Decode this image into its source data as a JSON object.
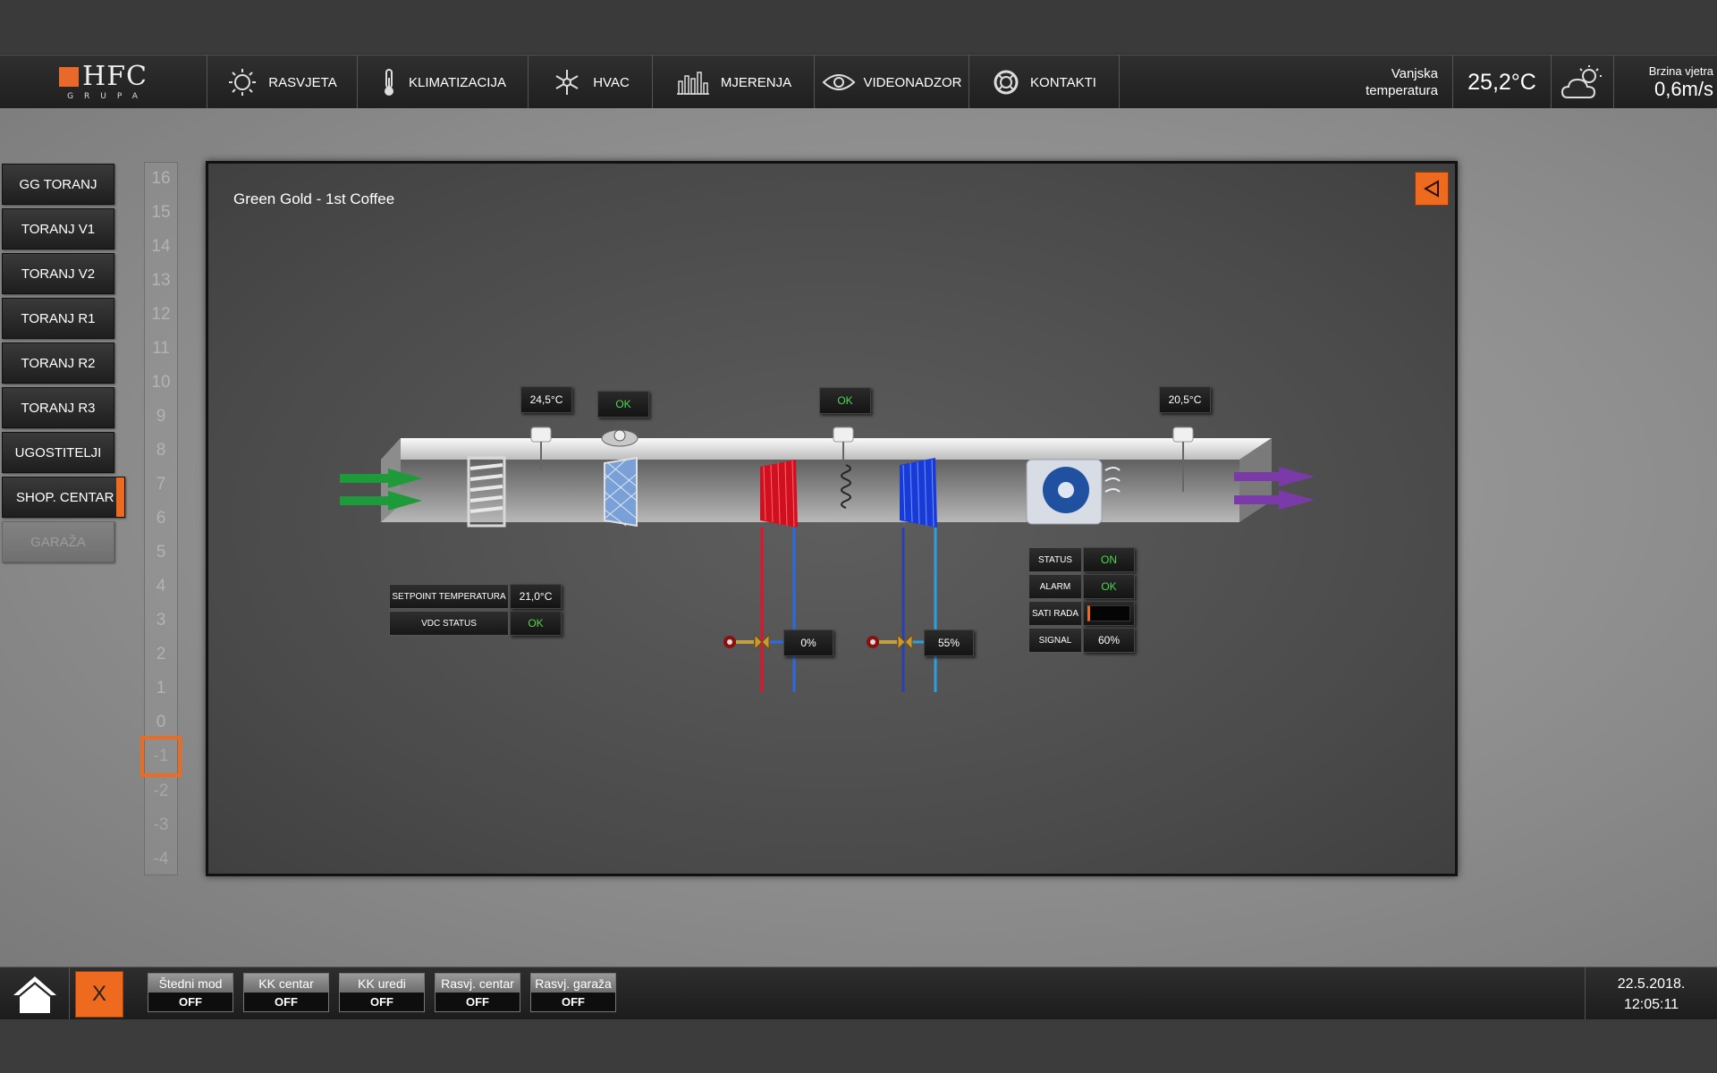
{
  "header": {
    "logo": {
      "text": "HFC",
      "sub": "GRUPA"
    },
    "tabs": [
      {
        "label": "RASVJETA",
        "icon": "lightbulb-icon"
      },
      {
        "label": "KLIMATIZACIJA",
        "icon": "thermometer-icon"
      },
      {
        "label": "HVAC",
        "icon": "snowflake-sun-icon"
      },
      {
        "label": "MJERENJA",
        "icon": "bar-chart-icon"
      },
      {
        "label": "VIDEONADZOR",
        "icon": "eye-icon"
      },
      {
        "label": "KONTAKTI",
        "icon": "lifebuoy-icon"
      }
    ],
    "active_tab": "KLIMATIZACIJA",
    "outdoor_temp_label_1": "Vanjska",
    "outdoor_temp_label_2": "temperatura",
    "outdoor_temp": "25,2°C",
    "weather_icon": "cloud-sun-icon",
    "wind_label": "Brzina vjetra",
    "wind_speed": "0,6m/s"
  },
  "sidebar": {
    "buildings": [
      "GG TORANJ",
      "TORANJ V1",
      "TORANJ V2",
      "TORANJ R1",
      "TORANJ R2",
      "TORANJ R3",
      "UGOSTITELJI",
      "SHOP. CENTAR",
      "GARAŽA"
    ],
    "active": "SHOP. CENTAR",
    "disabled": "GARAŽA",
    "floors": [
      "16",
      "15",
      "14",
      "13",
      "12",
      "11",
      "10",
      "9",
      "8",
      "7",
      "6",
      "5",
      "4",
      "3",
      "2",
      "1",
      "0",
      "-1",
      "-2",
      "-3",
      "-4"
    ],
    "selected_floor": "-1"
  },
  "panel": {
    "title": "Green Gold - 1st Coffee",
    "supply_temp": "24,5°C",
    "filter_status": "OK",
    "frost_status": "OK",
    "exhaust_temp": "20,5°C",
    "setpoint_label": "SETPOINT TEMPERATURA",
    "setpoint_value": "21,0°C",
    "vdc_label": "VDC STATUS",
    "vdc_value": "OK",
    "heating_valve": "0%",
    "cooling_valve": "55%",
    "fan": {
      "status_label": "STATUS",
      "status_value": "ON",
      "alarm_label": "ALARM",
      "alarm_value": "OK",
      "hours_label": "SATI RADA",
      "hours_value": "",
      "signal_label": "SIGNAL",
      "signal_value": "60%"
    },
    "colors": {
      "supply_arrow": "#1f9a3a",
      "exhaust_arrow": "#7a3aa8",
      "hot_pipe": "#e8102a",
      "cold_pipe": "#2a6ae8",
      "accent": "#ee6a1e",
      "ok": "#4fd64f"
    }
  },
  "footer": {
    "close_label": "X",
    "toggles": [
      {
        "label": "Štedni mod",
        "state": "OFF"
      },
      {
        "label": "KK centar",
        "state": "OFF"
      },
      {
        "label": "KK uredi",
        "state": "OFF"
      },
      {
        "label": "Rasvj. centar",
        "state": "OFF"
      },
      {
        "label": "Rasvj. garaža",
        "state": "OFF"
      }
    ],
    "date": "22.5.2018.",
    "time": "12:05:11"
  }
}
